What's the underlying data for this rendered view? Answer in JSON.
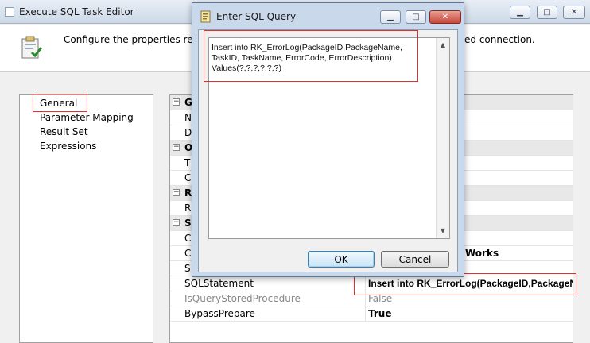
{
  "main_window": {
    "title": "Execute SQL Task Editor",
    "header_description": "Configure the properties requi",
    "header_description_tail": "ed connection."
  },
  "nav": {
    "items": [
      "General",
      "Parameter Mapping",
      "Result Set",
      "Expressions"
    ],
    "selected": "General"
  },
  "property_grid": {
    "rows": [
      {
        "type": "category",
        "name": "G",
        "value": ""
      },
      {
        "type": "property",
        "name": "N",
        "value": ""
      },
      {
        "type": "property",
        "name": "D",
        "value": ""
      },
      {
        "type": "category",
        "name": "O",
        "value": ""
      },
      {
        "type": "property",
        "name": "T",
        "value": ""
      },
      {
        "type": "property",
        "name": "C",
        "value": ""
      },
      {
        "type": "category",
        "name": "R",
        "value": ""
      },
      {
        "type": "property",
        "name": "R",
        "value": ""
      },
      {
        "type": "category",
        "name": "S",
        "value": ""
      },
      {
        "type": "property",
        "name": "C",
        "value": ""
      },
      {
        "type": "property",
        "name": "C",
        "value": "Works"
      },
      {
        "type": "property",
        "name": "S",
        "value": ""
      },
      {
        "type": "property",
        "name": "SQLStatement",
        "value": "Insert into RK_ErrorLog(PackageID,PackageNa"
      },
      {
        "type": "property",
        "name": "IsQueryStoredProcedure",
        "value": "False",
        "disabled": true
      },
      {
        "type": "property",
        "name": "BypassPrepare",
        "value": "True"
      }
    ]
  },
  "dialog": {
    "title": "Enter SQL Query",
    "query_text": "Insert into RK_ErrorLog(PackageID,PackageName,\nTaskID, TaskName, ErrorCode, ErrorDescription)\nValues(?,?,?,?,?,?)",
    "ok_label": "OK",
    "cancel_label": "Cancel"
  },
  "window_controls": {
    "minimize": "▁",
    "maximize": "□",
    "close": "✕"
  },
  "colors": {
    "highlight_box": "#e03030",
    "dialog_frame": "#c9d8ea"
  }
}
